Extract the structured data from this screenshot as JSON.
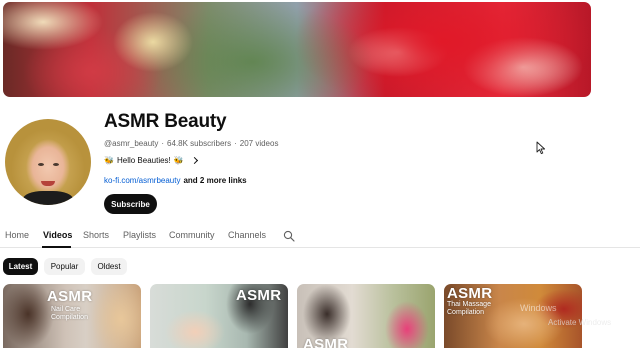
{
  "channel": {
    "name": "ASMR Beauty",
    "handle": "@asmr_beauty",
    "subscribers": "64.8K subscribers",
    "videos": "207 videos",
    "separator": "·",
    "description": "Hello Beauties!",
    "bee_emoji": "🐝",
    "link": "ko-fi.com/asmrbeauty",
    "more_links": "and 2 more links",
    "subscribe_label": "Subscribe"
  },
  "tabs": [
    {
      "label": "Home",
      "active": false
    },
    {
      "label": "Videos",
      "active": true
    },
    {
      "label": "Shorts",
      "active": false
    },
    {
      "label": "Playlists",
      "active": false
    },
    {
      "label": "Community",
      "active": false
    },
    {
      "label": "Channels",
      "active": false
    }
  ],
  "chips": [
    {
      "label": "Latest",
      "active": true
    },
    {
      "label": "Popular",
      "active": false
    },
    {
      "label": "Oldest",
      "active": false
    }
  ],
  "thumbnails": [
    {
      "title": "ASMR",
      "subtitle": "Nail Care Compilation"
    },
    {
      "title": "ASMR",
      "subtitle": ""
    },
    {
      "title": "ASMR",
      "subtitle": ""
    },
    {
      "title": "ASMR",
      "subtitle": "Thai Massage Compilation"
    }
  ],
  "overlay": {
    "watermark": "Windows",
    "activation": "Activate Windows"
  },
  "icons": {
    "search": "search-icon",
    "chevron": "chevron-right-icon",
    "cursor": "mouse-cursor-icon"
  },
  "colors": {
    "accent": "#0f0f0f",
    "link": "#065fd4",
    "muted": "#606060",
    "chip_bg": "#f2f2f2"
  }
}
